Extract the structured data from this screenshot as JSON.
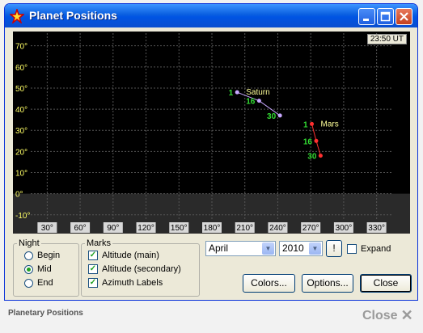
{
  "window": {
    "title": "Planet Positions"
  },
  "chart": {
    "time": "23:50 UT"
  },
  "chart_data": {
    "type": "scatter",
    "x_ticks": [
      "30°",
      "60°",
      "90°",
      "120°",
      "150°",
      "180°",
      "210°",
      "240°",
      "270°",
      "300°",
      "330°"
    ],
    "y_ticks": [
      "70°",
      "60°",
      "50°",
      "40°",
      "30°",
      "20°",
      "10°",
      "0°",
      "-10°"
    ],
    "xlim": [
      15,
      345
    ],
    "ylim": [
      -12,
      76
    ],
    "grid": true,
    "series": [
      {
        "name": "Saturn",
        "color": "#c8a8ff",
        "points": [
          {
            "label": "1",
            "x": 203,
            "y": 48
          },
          {
            "label": "16",
            "x": 223,
            "y": 44
          },
          {
            "label": "30",
            "x": 242,
            "y": 37
          }
        ]
      },
      {
        "name": "Mars",
        "color": "#ff3030",
        "points": [
          {
            "label": "1",
            "x": 271,
            "y": 33
          },
          {
            "label": "16",
            "x": 275,
            "y": 25
          },
          {
            "label": "30",
            "x": 279,
            "y": 18
          }
        ]
      }
    ]
  },
  "night": {
    "legend": "Night",
    "options": [
      {
        "label": "Begin",
        "selected": false
      },
      {
        "label": "Mid",
        "selected": true
      },
      {
        "label": "End",
        "selected": false
      }
    ]
  },
  "marks": {
    "legend": "Marks",
    "options": [
      {
        "label": "Altitude (main)",
        "checked": true
      },
      {
        "label": "Altitude (secondary)",
        "checked": true
      },
      {
        "label": "Azimuth Labels",
        "checked": true
      }
    ]
  },
  "controls": {
    "month": "April",
    "year": "2010",
    "bang": "!",
    "expand": "Expand",
    "colors": "Colors...",
    "options": "Options...",
    "close": "Close"
  },
  "footer": {
    "title": "Planetary Positions",
    "close": "Close"
  }
}
